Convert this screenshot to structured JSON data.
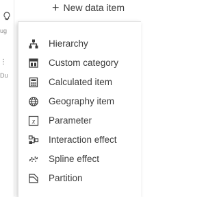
{
  "toolbar": {
    "new_data_item_label": "New data item"
  },
  "left_panel": {
    "fragment_1": "ug",
    "fragment_2": "⋮",
    "fragment_3": "Du"
  },
  "menu": {
    "items": [
      {
        "label": "Hierarchy",
        "icon": "hierarchy-icon"
      },
      {
        "label": "Custom category",
        "icon": "custom-category-icon"
      },
      {
        "label": "Calculated item",
        "icon": "calculator-icon"
      },
      {
        "label": "Geography item",
        "icon": "globe-icon"
      },
      {
        "label": "Parameter",
        "icon": "parameter-icon"
      },
      {
        "label": "Interaction effect",
        "icon": "interaction-effect-icon"
      },
      {
        "label": "Spline effect",
        "icon": "spline-effect-icon"
      },
      {
        "label": "Partition",
        "icon": "partition-icon"
      }
    ]
  }
}
